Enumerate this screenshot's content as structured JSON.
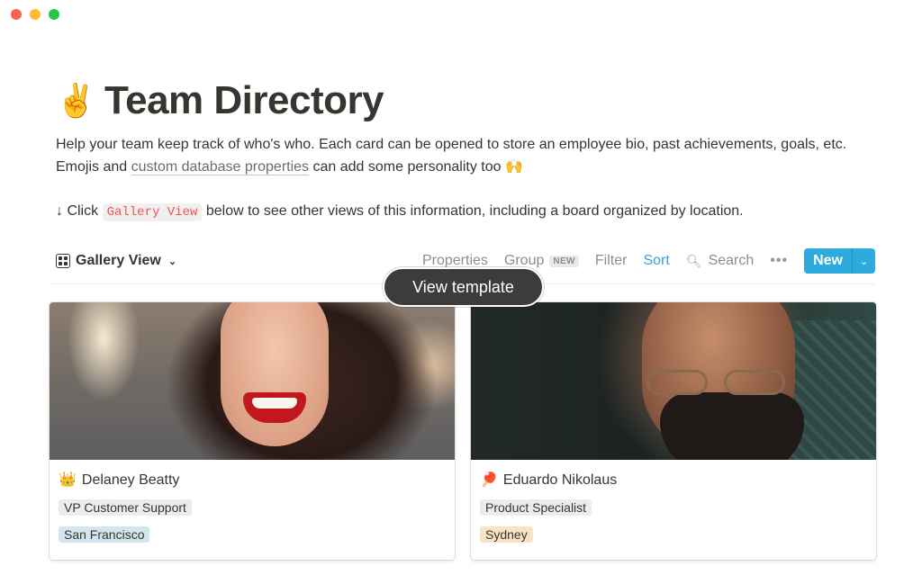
{
  "window": {
    "controls": [
      "close",
      "minimize",
      "zoom"
    ]
  },
  "page": {
    "icon": "✌️",
    "icon_name": "victory-hand-emoji",
    "title": "Team Directory",
    "description": {
      "line1": "Help your team keep track of who's who. Each card can be opened to store an employee bio, past achievements, goals, etc.",
      "line2_prefix": "Emojis and ",
      "link_text": "custom database properties",
      "line2_suffix": " can add some personality too ",
      "line2_emoji": "🙌"
    },
    "hint": {
      "arrow": "↓",
      "prefix": " Click ",
      "code": "Gallery View",
      "suffix": " below to see other views of this information, including a board organized by location."
    }
  },
  "toolbar": {
    "view_label": "Gallery View",
    "properties_label": "Properties",
    "group_label": "Group",
    "group_badge": "NEW",
    "filter_label": "Filter",
    "sort_label": "Sort",
    "search_label": "Search",
    "more_label": "•••",
    "new_label": "New",
    "accent_color": "#2eaadc",
    "sort_color": "#3aa2d6"
  },
  "tooltip": {
    "label": "View template"
  },
  "cards": [
    {
      "emoji": "👑",
      "name": "Delaney Beatty",
      "role": "VP Customer Support",
      "location": "San Francisco",
      "location_color": "#d3e5ef"
    },
    {
      "emoji": "🏓",
      "name": "Eduardo Nikolaus",
      "role": "Product Specialist",
      "location": "Sydney",
      "location_color": "#fae3c4"
    }
  ]
}
